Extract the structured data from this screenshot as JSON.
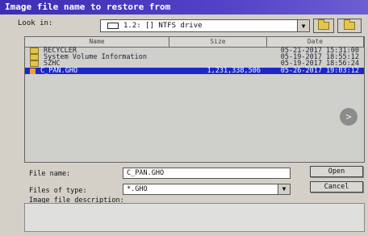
{
  "window": {
    "title": "Image file name to restore from"
  },
  "look_in": {
    "label": "Look in:",
    "value": "1.2: [] NTFS drive",
    "drive_icon": "drive-icon"
  },
  "toolbar": {
    "up_icon": "up-folder-icon",
    "new_folder_icon": "new-folder-icon"
  },
  "columns": {
    "name": "Name",
    "size": "Size",
    "date": "Date"
  },
  "files": [
    {
      "name": "RECYCLER",
      "size": "",
      "date": "05-21-2017 15:31:00",
      "type": "folder"
    },
    {
      "name": "System Volume Information",
      "size": "",
      "date": "05-19-2017 18:55:12",
      "type": "folder"
    },
    {
      "name": "SZHC",
      "size": "",
      "date": "05-19-2017 18:56:24",
      "type": "folder"
    },
    {
      "name": "C_PAN.GHO",
      "size": "1,231,338,506",
      "date": "05-26-2017 19:03:12",
      "type": "file",
      "selected": true
    }
  ],
  "file_name": {
    "label": "File name:",
    "value": "C_PAN.GHO"
  },
  "file_type": {
    "label": "Files of type:",
    "value": "*.GHO"
  },
  "description": {
    "label": "Image file description:",
    "value": ""
  },
  "buttons": {
    "open": "Open",
    "cancel": "Cancel"
  },
  "colors": {
    "title_bar": "#3d2fb4",
    "selection": "#1d27c8",
    "folder": "#e3c54a"
  }
}
